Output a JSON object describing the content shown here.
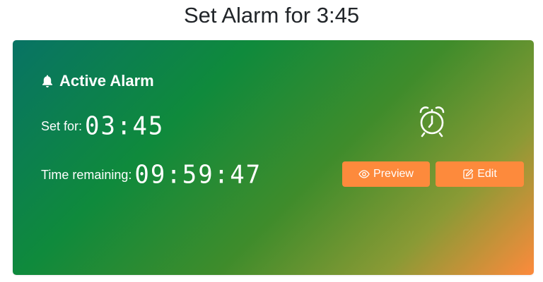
{
  "page": {
    "title": "Set Alarm for 3:45"
  },
  "alarm_card": {
    "heading": "Active Alarm",
    "heading_icon": "bell-icon",
    "set_for_label": "Set for:",
    "set_for_value": "03:45",
    "remaining_label": "Time remaining:",
    "remaining_value": "09:59:47",
    "status_icon": "alarm-clock-icon",
    "gradient_colors": [
      "#087364",
      "#0f8a3c",
      "#8a9a35",
      "#fd8a3c"
    ]
  },
  "actions": {
    "preview_label": "Preview",
    "preview_icon": "eye-icon",
    "edit_label": "Edit",
    "edit_icon": "edit-icon",
    "button_color": "#fd8a3c"
  }
}
